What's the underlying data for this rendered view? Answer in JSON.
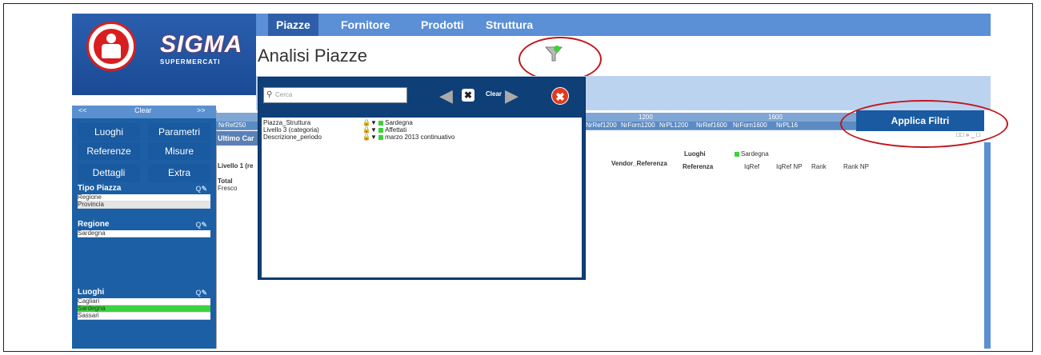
{
  "nav": {
    "tabs": [
      {
        "label": "Piazze"
      },
      {
        "label": "Fornitore"
      },
      {
        "label": "Prodotti"
      },
      {
        "label": "Struttura"
      }
    ]
  },
  "logo": {
    "name": "SIGMA",
    "tagline": "SUPERMERCATI"
  },
  "page": {
    "title": "Analisi Piazze"
  },
  "left_panel": {
    "top": {
      "prev": "<<",
      "clear": "Clear",
      "next": ">>"
    },
    "buttons": [
      "Luoghi",
      "Parametri",
      "Referenze",
      "Misure",
      "Dettagli",
      "Extra"
    ],
    "tipo_piazza": {
      "title": "Tipo Piazza",
      "items": [
        "Regione",
        "Provincia"
      ]
    },
    "regione": {
      "title": "Regione",
      "items": [
        "Sardegna"
      ]
    },
    "luoghi": {
      "title": "Luoghi",
      "items": [
        "Cagliari",
        "Sardegna",
        "Sassari"
      ]
    }
  },
  "columns": {
    "groups": [
      "1200",
      "1600"
    ],
    "headers": [
      "NrRef250",
      "NrRef1200",
      "NrForn1200",
      "NrPL1200",
      "NrRef1600",
      "NrForn1600",
      "NrPL16"
    ]
  },
  "table": {
    "band": "Ultimo Car",
    "luoghi_label": "Luoghi",
    "luoghi_value": "Sardegna",
    "level_col": "Livello 1 (re",
    "vendor_col": "Vendor_Referenza",
    "referenza_col": "Referenza",
    "metric_cols": [
      "IqRef",
      "IqRef NP",
      "Rank",
      "Rank NP"
    ],
    "rows": [
      "Total",
      "Fresco"
    ]
  },
  "applica": {
    "label": "Applica Filtri"
  },
  "popup": {
    "search_placeholder": "Cerca",
    "clear_label": "Clear",
    "filters": [
      {
        "field": "Piazza_Struttura",
        "value": "Sardegna"
      },
      {
        "field": "Livello 3 (categoria)",
        "value": "Affettati"
      },
      {
        "field": "Descrizione_periodo",
        "value": "marzo 2013 continuativo"
      }
    ]
  },
  "colors": {
    "accent": "#1a5aa0",
    "highlight": "#c0181c",
    "selected": "#3bd23b"
  }
}
